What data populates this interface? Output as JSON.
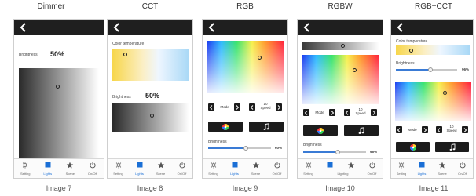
{
  "panels": [
    {
      "title": "Dimmer",
      "caption": "Image 7"
    },
    {
      "title": "CCT",
      "caption": "Image 8"
    },
    {
      "title": "RGB",
      "caption": "Image 9"
    },
    {
      "title": "RGBW",
      "caption": "Image 10"
    },
    {
      "title": "RGB+CCT",
      "caption": "Image 11"
    }
  ],
  "labels": {
    "brightness": "Brightness",
    "color_temperature": "Color temperature",
    "mode": "Mode",
    "speed_value": "10",
    "speed": "Speed"
  },
  "values": {
    "dimmer_brightness": "50%",
    "cct_brightness": "50%",
    "rgb_slider_pct": "60%",
    "rgbw_slider_pct": "96%",
    "rgbcct_slider_pct": "96%"
  },
  "tabs": [
    "Setting",
    "Lights",
    "Scene",
    "On/Off"
  ],
  "tabs_rgbw": [
    "Setting",
    "",
    "Lighting",
    "On/Off"
  ],
  "icons": [
    "back-arrow-icon",
    "gear-icon",
    "lights-square-icon",
    "star-icon",
    "power-icon",
    "chevron-left-icon",
    "chevron-right-icon",
    "color-wheel-icon",
    "music-note-icon"
  ],
  "colors": {
    "topbar": "#1f1f1f",
    "active_tab": "#1a6fd6",
    "slider_fill": "#3a7bd5"
  }
}
